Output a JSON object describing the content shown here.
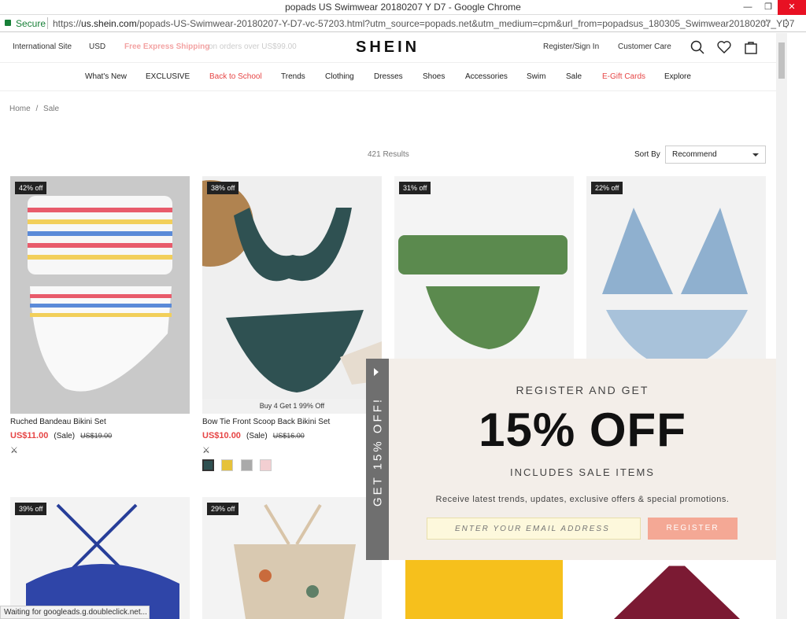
{
  "browser": {
    "title": "popads US Swimwear 20180207 Y D7 - Google Chrome",
    "secure_label": "Secure",
    "url_scheme": "https://",
    "url_host": "us.shein.com",
    "url_rest": "/popads-US-Swimwear-20180207-Y-D7-vc-57203.html?utm_source=popads.net&utm_medium=cpm&url_from=popadsus_180305_Swimwear20180207_YD7",
    "status": "Waiting for googleads.g.doubleclick.net..."
  },
  "topbar": {
    "international": "International Site",
    "currency": "USD",
    "shipping_promo": "Free Express Shipping",
    "shipping_tail": "on orders over US$99.00",
    "logo": "SHEIN",
    "register": "Register/Sign In",
    "customer_care": "Customer Care"
  },
  "nav": [
    "What's New",
    "EXCLUSIVE",
    "Back to School",
    "Trends",
    "Clothing",
    "Dresses",
    "Shoes",
    "Accessories",
    "Swim",
    "Sale",
    "E-Gift Cards",
    "Explore"
  ],
  "breadcrumb": {
    "home": "Home",
    "sep": "/",
    "current": "Sale"
  },
  "results": "421 Results",
  "sort": {
    "label": "Sort By",
    "value": "Recommend"
  },
  "products": [
    {
      "badge": "42% off",
      "name": "Ruched Bandeau Bikini Set",
      "price": "US$11.00",
      "sale": "(Sale)",
      "was": "US$19.00"
    },
    {
      "badge": "38% off",
      "name": "Bow Tie Front Scoop Back Bikini Set",
      "price": "US$10.00",
      "sale": "(Sale)",
      "was": "US$16.00",
      "promo": "Buy 4 Get 1 99% Off"
    },
    {
      "badge": "31% off"
    },
    {
      "badge": "22% off"
    },
    {
      "badge": "39% off"
    },
    {
      "badge": "29% off"
    }
  ],
  "popup": {
    "tab_label": "GET 15% OFF!",
    "heading": "REGISTER AND GET",
    "offer": "15% OFF",
    "subheading": "INCLUDES SALE ITEMS",
    "description": "Receive latest trends, updates, exclusive offers & special promotions.",
    "email_placeholder": "ENTER YOUR EMAIL ADDRESS",
    "register_label": "REGISTER"
  },
  "colors": {
    "accent_red": "#e64545",
    "popup_button": "#f4a895",
    "email_bg": "#fdf8dc"
  }
}
